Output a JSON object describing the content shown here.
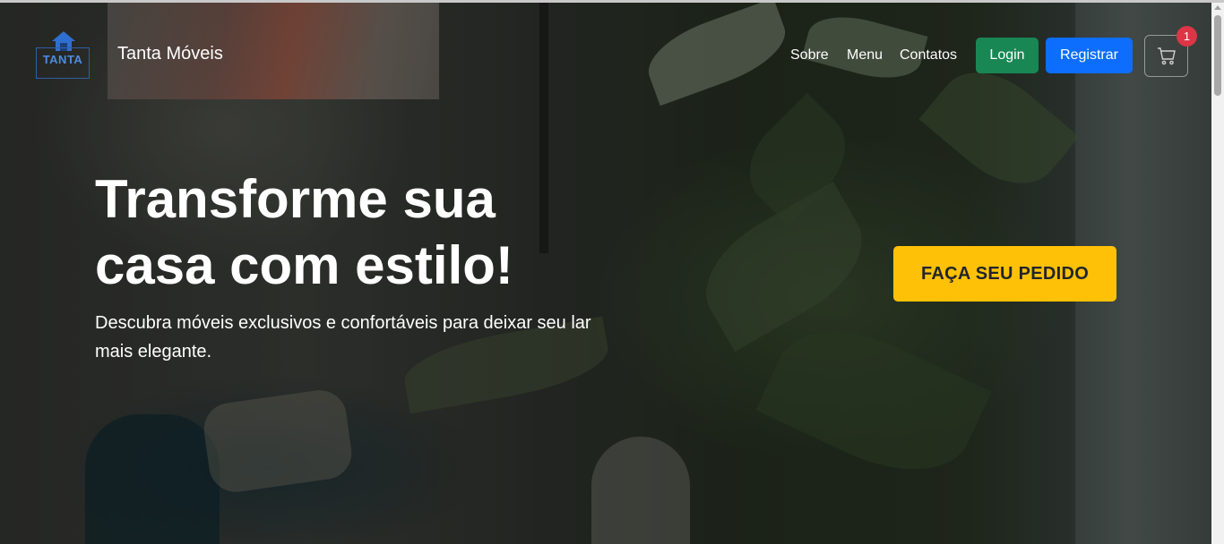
{
  "brand": {
    "name": "Tanta Móveis",
    "logo_text": "TANTA"
  },
  "nav": {
    "links": [
      {
        "label": "Sobre"
      },
      {
        "label": "Menu"
      },
      {
        "label": "Contatos"
      }
    ],
    "login_label": "Login",
    "register_label": "Registrar",
    "cart_count": "1"
  },
  "hero": {
    "headline": "Transforme sua casa com estilo!",
    "subtitle": "Descubra móveis exclusivos e confortáveis para deixar seu lar mais elegante.",
    "cta_label": "FAÇA SEU PEDIDO"
  },
  "colors": {
    "login": "#198754",
    "register": "#0d6efd",
    "cta": "#ffc107",
    "badge": "#dc3545"
  }
}
